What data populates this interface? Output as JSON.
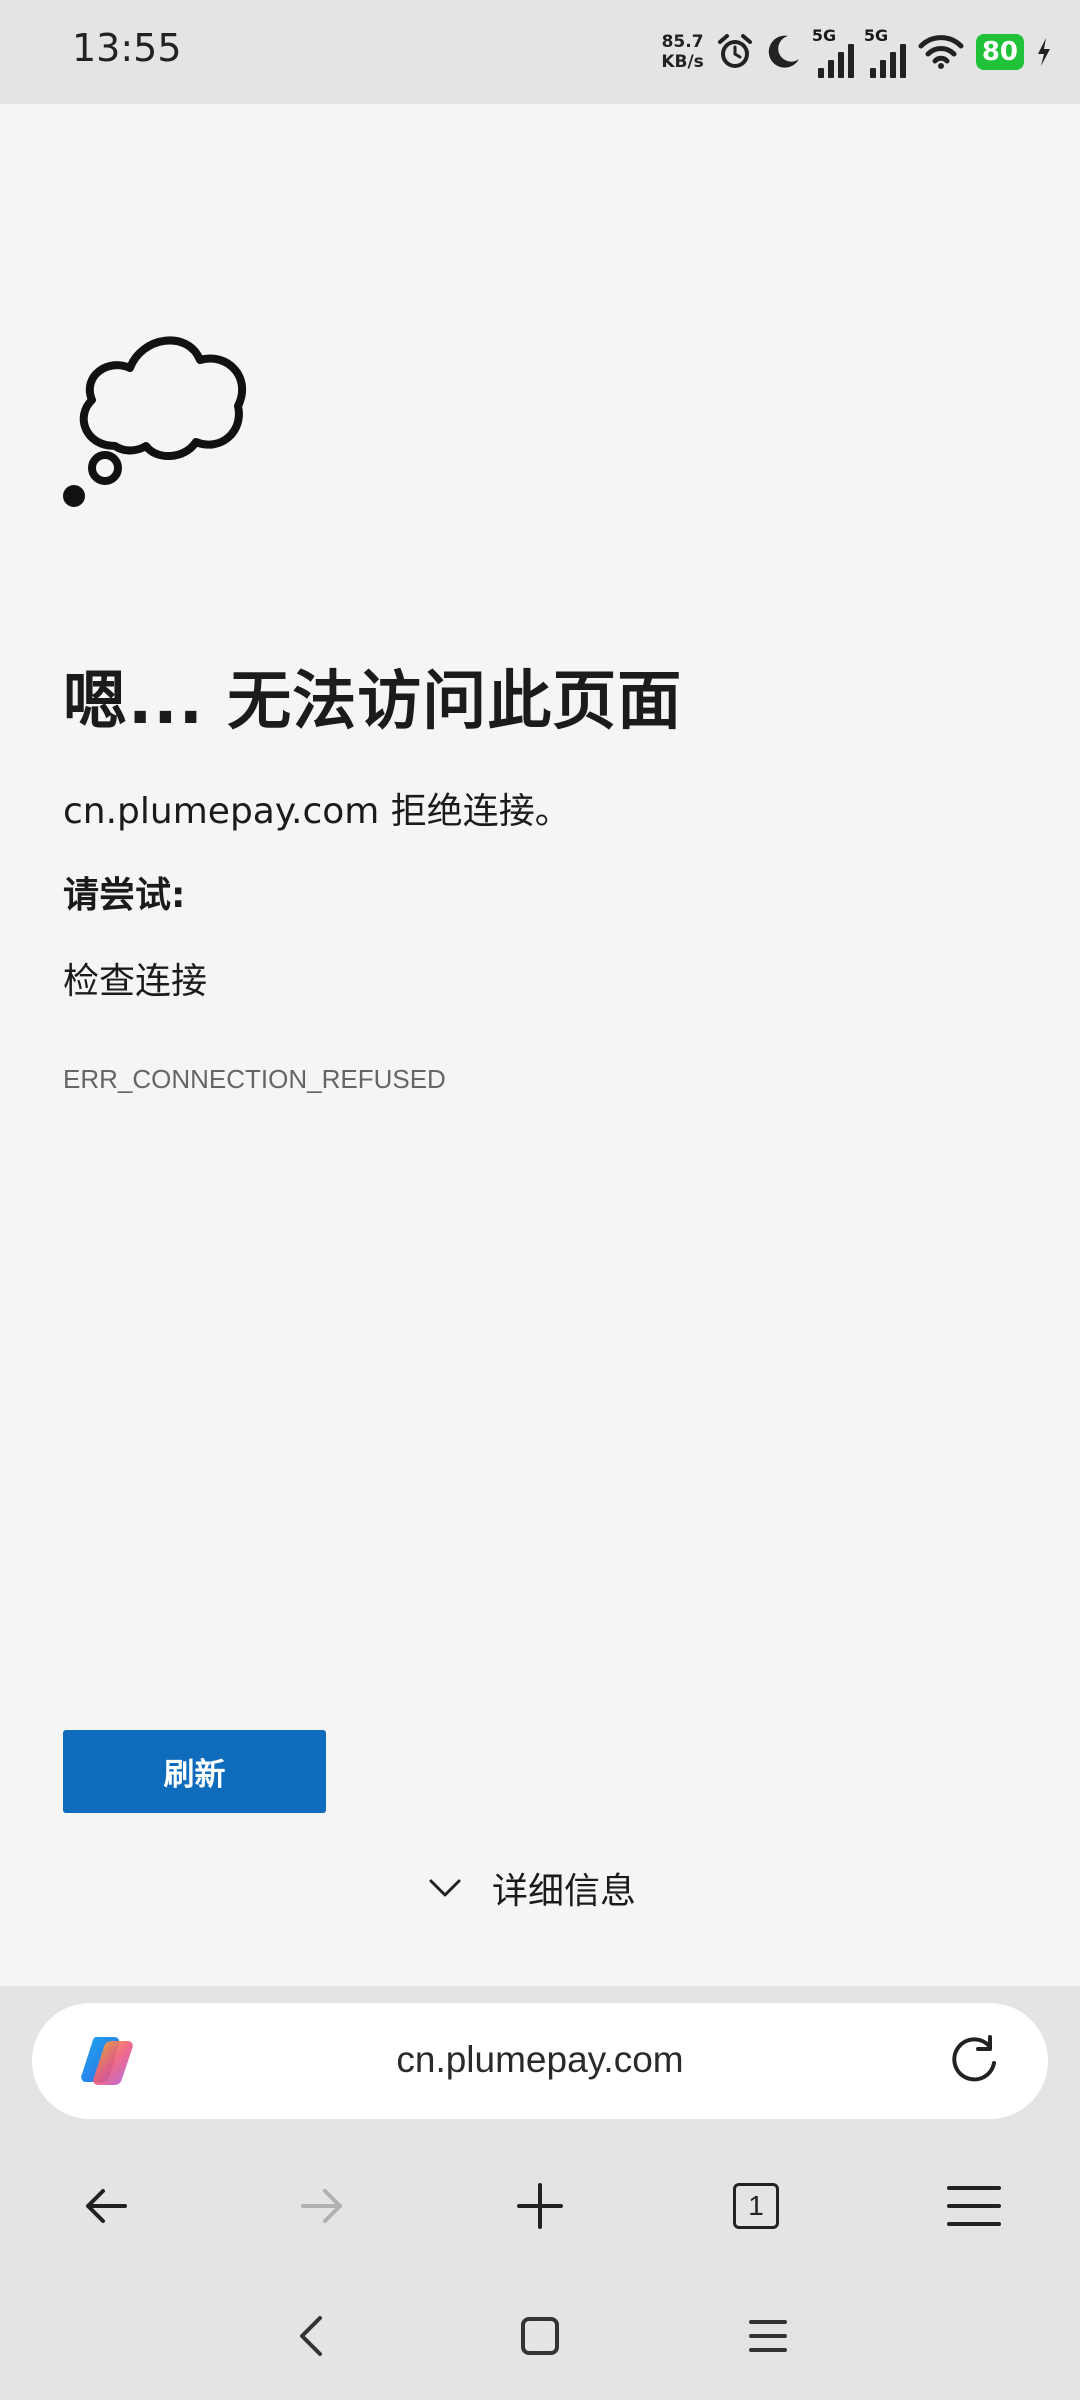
{
  "status_bar": {
    "time": "13:55",
    "net_speed_value": "85.7",
    "net_speed_unit": "KB/s",
    "signal1_label": "5G",
    "signal2_label": "5G",
    "battery": "80",
    "icons": [
      "alarm-icon",
      "moon-icon",
      "signal-icon",
      "wifi-icon",
      "battery-icon",
      "charging-icon"
    ]
  },
  "error_page": {
    "title": "嗯... 无法访问此页面",
    "message": "cn.plumepay.com 拒绝连接。",
    "try_label": "请尝试:",
    "suggestion": "检查连接",
    "error_code": "ERR_CONNECTION_REFUSED",
    "refresh_label": "刷新",
    "details_label": "详细信息",
    "icon": "thought-cloud-icon"
  },
  "address_bar": {
    "url": "cn.plumepay.com"
  },
  "toolbar": {
    "tab_count": "1"
  },
  "colors": {
    "accent": "#0f6cbd",
    "battery": "#1fc238",
    "page_bg": "#f5f5f5",
    "chrome_bg": "#e4e4e4"
  }
}
